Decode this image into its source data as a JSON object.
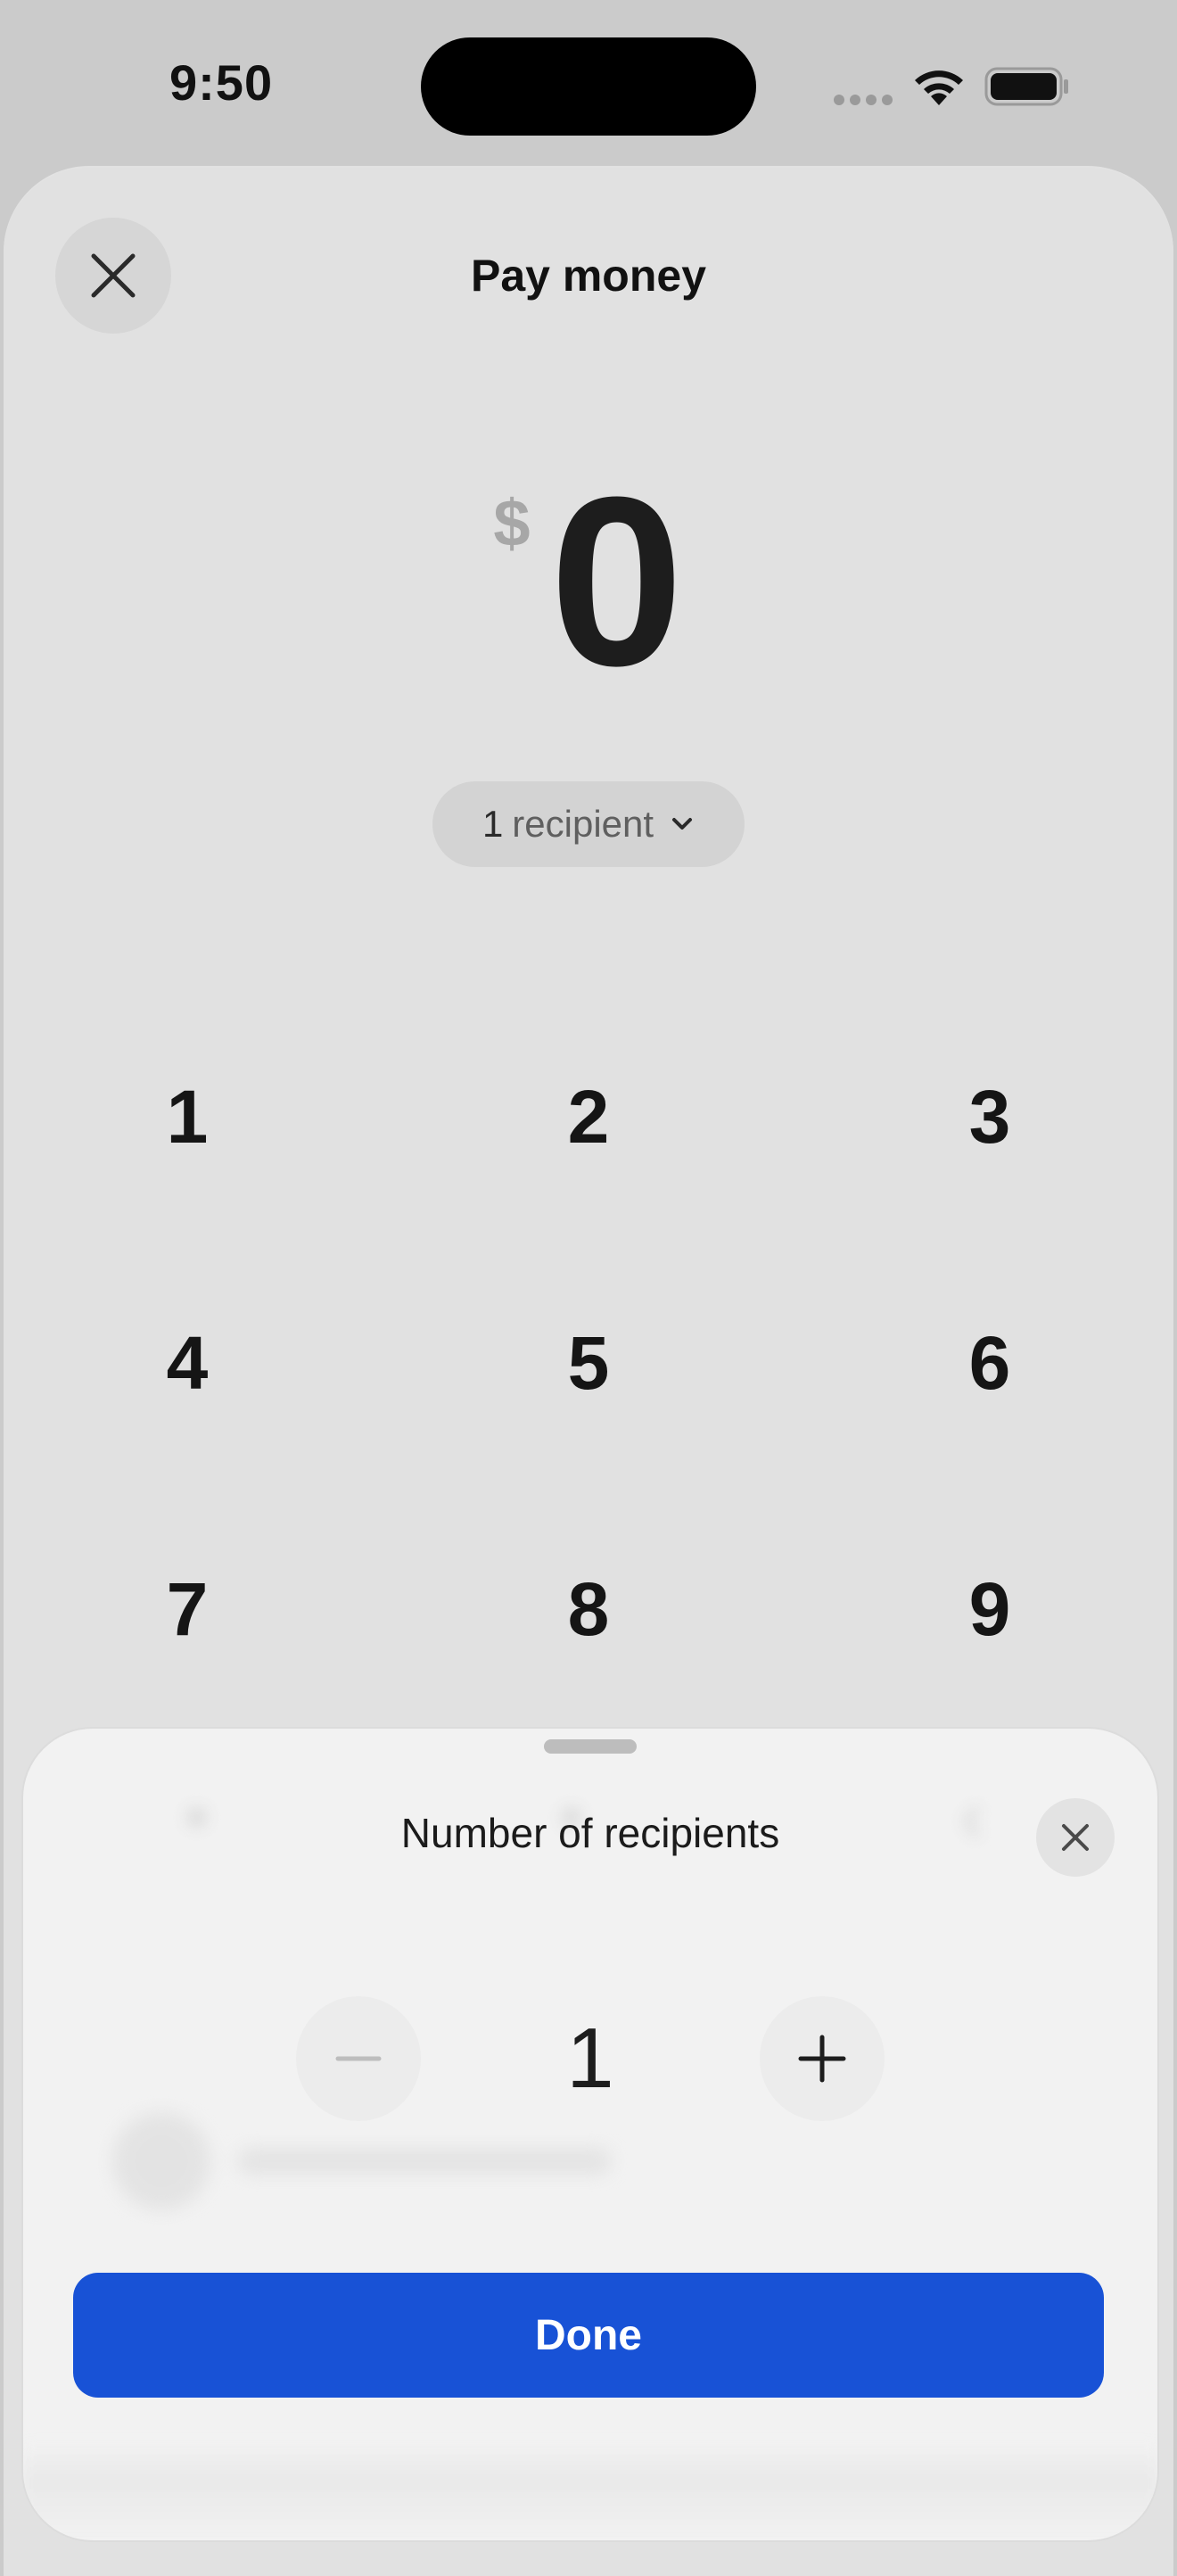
{
  "status_bar": {
    "time": "9:50",
    "icons": [
      "cellular-dots-icon",
      "wifi-icon",
      "battery-icon"
    ]
  },
  "header": {
    "title": "Pay money",
    "close_icon": "close-icon"
  },
  "amount": {
    "currency_symbol": "$",
    "value": "0"
  },
  "recipient_selector": {
    "count": "1",
    "label": "recipient",
    "icon": "chevron-down-icon"
  },
  "keypad": {
    "keys": [
      "1",
      "2",
      "3",
      "4",
      "5",
      "6",
      "7",
      "8",
      "9"
    ]
  },
  "sheet": {
    "title": "Number of recipients",
    "close_icon": "close-icon",
    "stepper": {
      "value": "1",
      "decrement_icon": "minus-icon",
      "increment_icon": "plus-icon"
    },
    "done_label": "Done"
  },
  "colors": {
    "accent": "#1852d6",
    "background": "#e1e1e1",
    "sheet": "#f2f2f2"
  }
}
